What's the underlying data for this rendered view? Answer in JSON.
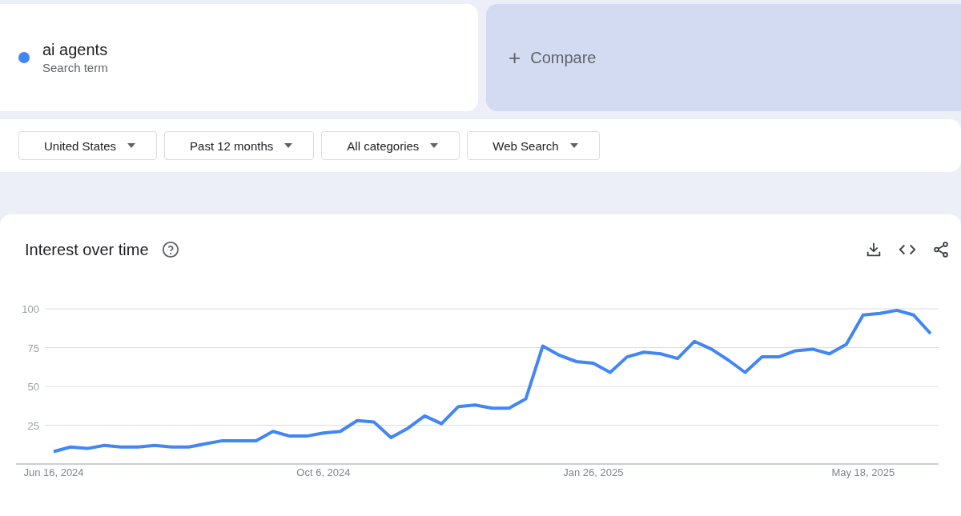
{
  "term": {
    "name": "ai agents",
    "subtitle": "Search term",
    "color": "#4285f4"
  },
  "compare": {
    "icon": "+",
    "label": "Compare"
  },
  "filters": [
    {
      "label": "United States"
    },
    {
      "label": "Past 12 months"
    },
    {
      "label": "All categories"
    },
    {
      "label": "Web Search"
    }
  ],
  "interest_over_time": {
    "title": "Interest over time",
    "chart_data": {
      "type": "line",
      "ylim": [
        0,
        100
      ],
      "yticks": [
        25,
        50,
        75,
        100
      ],
      "grid": true,
      "categories": [
        "Jun 16, 2024",
        null,
        null,
        null,
        null,
        null,
        null,
        null,
        null,
        null,
        null,
        null,
        null,
        null,
        null,
        null,
        "Oct 6, 2024",
        null,
        null,
        null,
        null,
        null,
        null,
        null,
        null,
        null,
        null,
        null,
        null,
        null,
        null,
        null,
        "Jan 26, 2025",
        null,
        null,
        null,
        null,
        null,
        null,
        null,
        null,
        null,
        null,
        null,
        null,
        null,
        null,
        null,
        "May 18, 2025",
        null,
        null,
        null,
        null
      ],
      "series": [
        {
          "color": "#4285f4",
          "values": [
            8,
            11,
            10,
            12,
            11,
            11,
            12,
            11,
            11,
            13,
            15,
            15,
            15,
            21,
            18,
            18,
            20,
            21,
            28,
            27,
            17,
            23,
            31,
            26,
            37,
            38,
            36,
            36,
            42,
            76,
            70,
            66,
            65,
            59,
            69,
            72,
            71,
            68,
            79,
            74,
            67,
            59,
            69,
            69,
            73,
            74,
            71,
            77,
            96,
            97,
            99,
            96,
            84
          ]
        }
      ]
    }
  }
}
